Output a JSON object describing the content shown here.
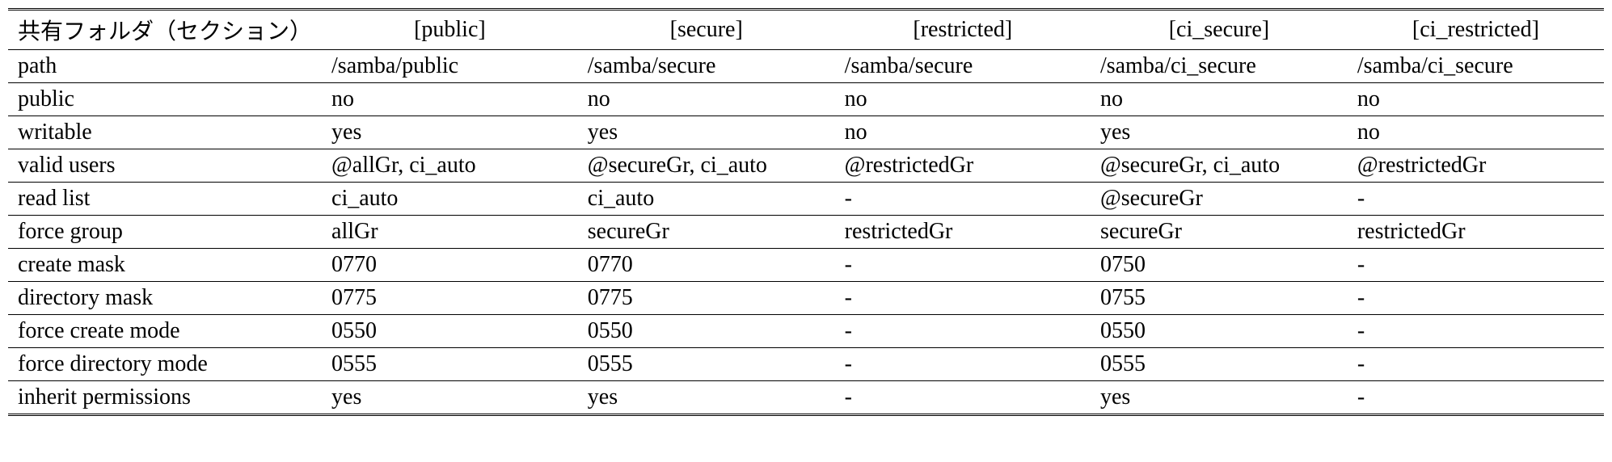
{
  "chart_data": {
    "type": "table",
    "row_label_header": "共有フォルダ（セクション）",
    "columns": [
      "[public]",
      "[secure]",
      "[restricted]",
      "[ci_secure]",
      "[ci_restricted]"
    ],
    "rows": [
      {
        "label": "path",
        "values": [
          "/samba/public",
          "/samba/secure",
          "/samba/secure",
          "/samba/ci_secure",
          "/samba/ci_secure"
        ]
      },
      {
        "label": "public",
        "values": [
          "no",
          "no",
          "no",
          "no",
          "no"
        ]
      },
      {
        "label": "writable",
        "values": [
          "yes",
          "yes",
          "no",
          "yes",
          "no"
        ]
      },
      {
        "label": "valid users",
        "values": [
          "@allGr, ci_auto",
          "@secureGr, ci_auto",
          "@restrictedGr",
          "@secureGr, ci_auto",
          "@restrictedGr"
        ]
      },
      {
        "label": "read list",
        "values": [
          "ci_auto",
          "ci_auto",
          "-",
          "@secureGr",
          "-"
        ]
      },
      {
        "label": "force group",
        "values": [
          "allGr",
          "secureGr",
          "restrictedGr",
          "secureGr",
          "restrictedGr"
        ]
      },
      {
        "label": "create mask",
        "values": [
          "0770",
          "0770",
          "-",
          "0750",
          "-"
        ]
      },
      {
        "label": "directory mask",
        "values": [
          "0775",
          "0775",
          "-",
          "0755",
          "-"
        ]
      },
      {
        "label": "force create mode",
        "values": [
          "0550",
          "0550",
          "-",
          "0550",
          "-"
        ]
      },
      {
        "label": "force directory mode",
        "values": [
          "0555",
          "0555",
          "-",
          "0555",
          "-"
        ]
      },
      {
        "label": "inherit permissions",
        "values": [
          "yes",
          "yes",
          "-",
          "yes",
          "-"
        ]
      }
    ]
  }
}
